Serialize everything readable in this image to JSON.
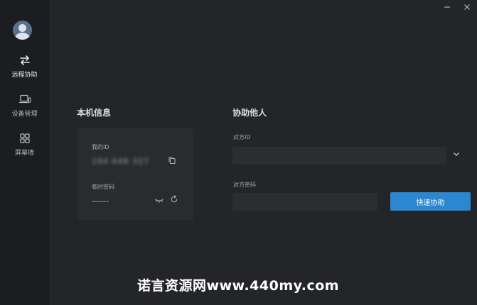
{
  "sidebar": {
    "items": [
      {
        "label": "远程协助",
        "icon": "swap-arrows-icon",
        "active": true
      },
      {
        "label": "设备管理",
        "icon": "device-icon",
        "active": false
      },
      {
        "label": "屏幕墙",
        "icon": "grid-icon",
        "active": false
      }
    ]
  },
  "window_controls": [
    "minimize-icon",
    "close-icon"
  ],
  "local_info": {
    "title": "本机信息",
    "id_label": "我的ID",
    "id_value": "194 648 327",
    "password_label": "临时密码",
    "password_value": "------"
  },
  "assist": {
    "title": "协助他人",
    "peer_id_label": "对方ID",
    "peer_id_value": "",
    "peer_password_label": "对方密码",
    "peer_password_value": "",
    "connect_label": "快速协助"
  },
  "watermark": "诺言资源网www.440my.com",
  "colors": {
    "accent": "#2b87cf",
    "sidebar_bg": "#1c1d21",
    "main_bg": "#242529",
    "card_bg": "#2a2b2f",
    "input_bg": "#2c2d31"
  }
}
